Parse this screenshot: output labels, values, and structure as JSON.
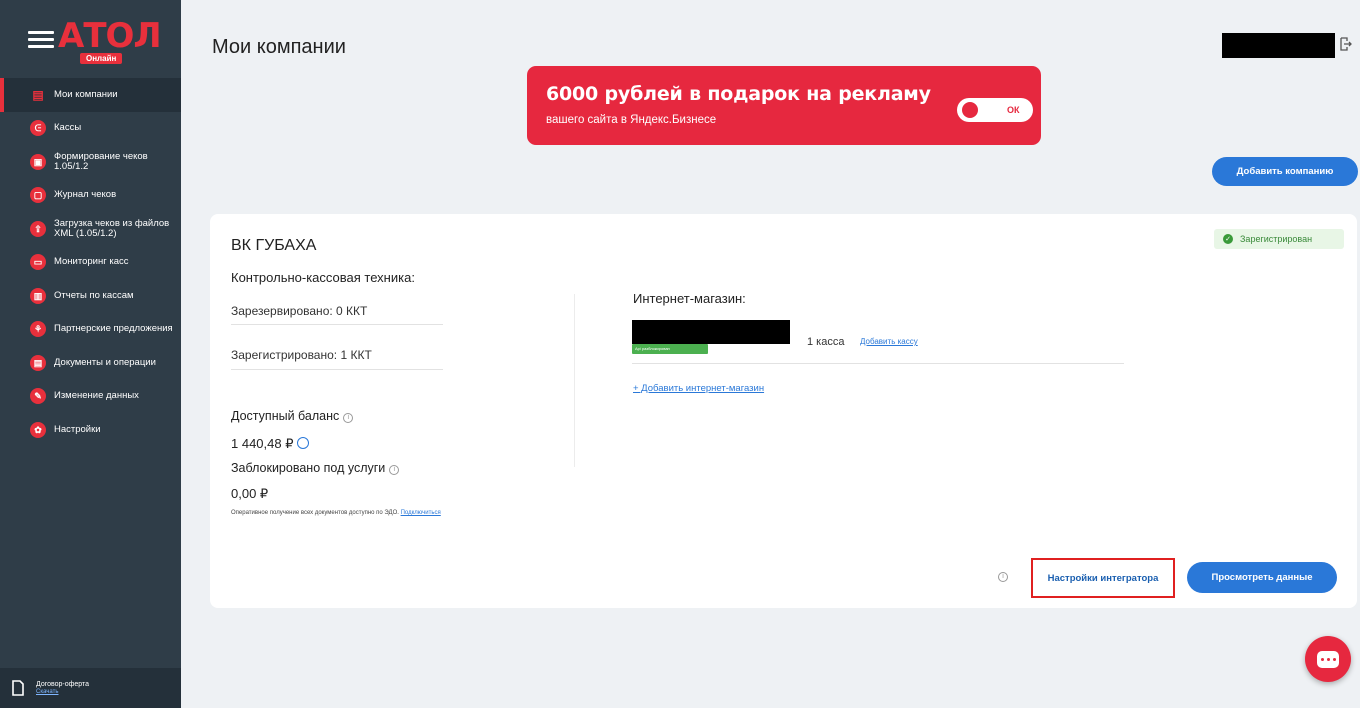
{
  "brand": {
    "logo": "АТОЛ",
    "badge": "Онлайн"
  },
  "sidebar": {
    "items": [
      {
        "label": "Мои компании",
        "icon": "store-icon",
        "active": true
      },
      {
        "label": "Кассы",
        "icon": "cash-register-icon"
      },
      {
        "label": "Формирование чеков 1.05/1.2",
        "icon": "receipt-form-icon"
      },
      {
        "label": "Журнал чеков",
        "icon": "journal-icon"
      },
      {
        "label": "Загрузка чеков из файлов XML (1.05/1.2)",
        "icon": "upload-icon"
      },
      {
        "label": "Мониторинг касс",
        "icon": "monitor-icon"
      },
      {
        "label": "Отчеты по кассам",
        "icon": "report-icon"
      },
      {
        "label": "Партнерские предложения",
        "icon": "partner-icon"
      },
      {
        "label": "Документы и операции",
        "icon": "documents-icon"
      },
      {
        "label": "Изменение данных",
        "icon": "edit-icon"
      },
      {
        "label": "Настройки",
        "icon": "settings-icon"
      }
    ],
    "footer": {
      "label": "Договор-оферта",
      "link": "Скачать"
    }
  },
  "header": {
    "title": "Мои компании"
  },
  "promo": {
    "title": "6000 рублей в подарок на рекламу",
    "subtitle": "вашего сайта в Яндекс.Бизнесе",
    "toggle_label": "ОК"
  },
  "actions": {
    "add_company": "Добавить компанию"
  },
  "company": {
    "name": "ВК ГУБАХА",
    "status": "Зарегистрирован",
    "kkt_heading": "Контрольно-кассовая техника:",
    "reserved": "Зарезервировано: 0 ККТ",
    "registered": "Зарегистрировано: 1 ККТ",
    "balance_label": "Доступный баланс",
    "balance_value": "1 440,48 ₽",
    "blocked_label": "Заблокировано под услуги",
    "blocked_value": "0,00 ₽",
    "edo_note": "Оперативное получение всех документов доступно по ЭДО.",
    "edo_link": "Подключиться",
    "shop_heading": "Интернет-магазин:",
    "shop_tag": "Api разблокирован",
    "kassa_count": "1 касса",
    "add_kassa": "Добавить кассу",
    "add_shop": "+ Добавить интернет-магазин",
    "integrator_settings": "Настройки интегратора",
    "view_data": "Просмотреть данные"
  }
}
